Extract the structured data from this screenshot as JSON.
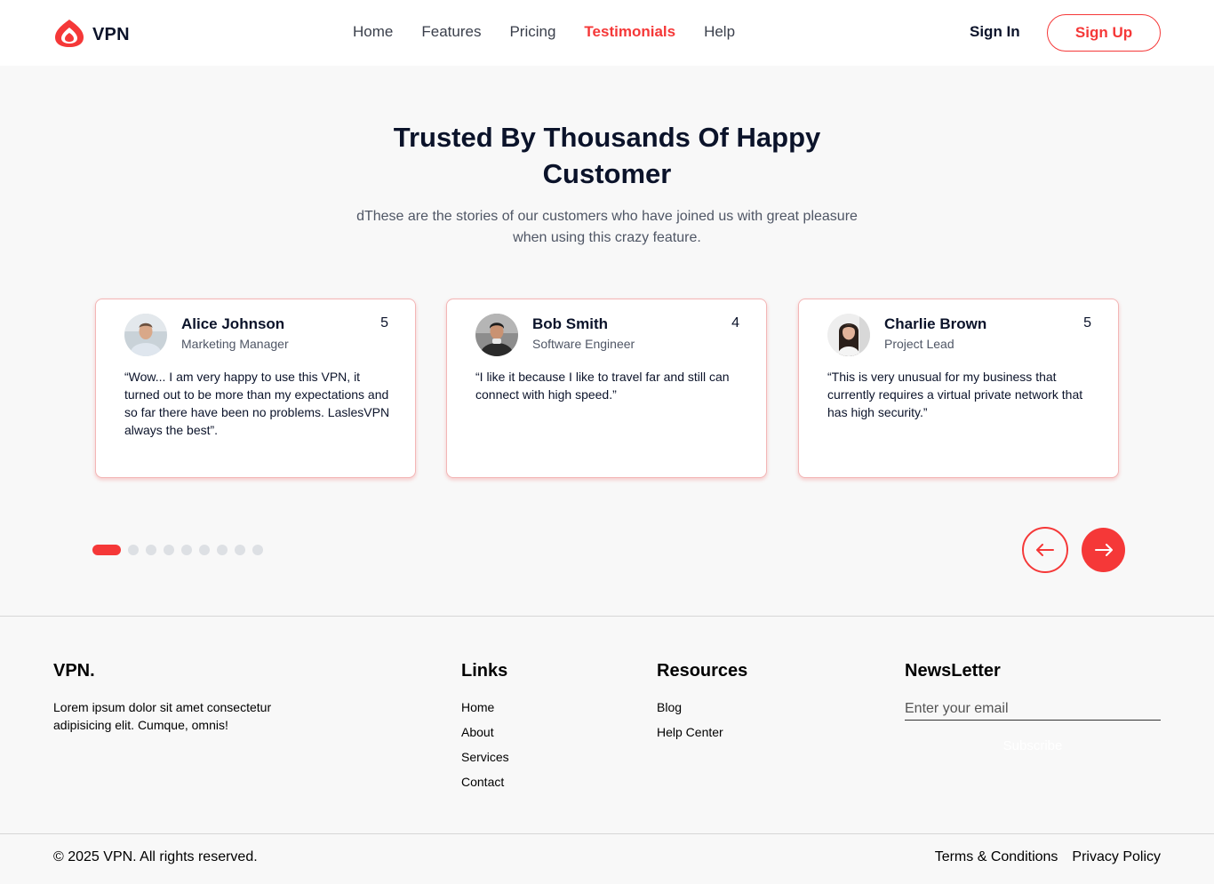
{
  "header": {
    "brand": "VPN",
    "nav": [
      {
        "label": "Home",
        "active": false
      },
      {
        "label": "Features",
        "active": false
      },
      {
        "label": "Pricing",
        "active": false
      },
      {
        "label": "Testimonials",
        "active": true
      },
      {
        "label": "Help",
        "active": false
      }
    ],
    "sign_in": "Sign In",
    "sign_up": "Sign Up"
  },
  "hero": {
    "title": "Trusted By Thousands Of Happy Customer",
    "subtitle": "dThese are the stories of our customers who have joined us with great pleasure when using this crazy feature."
  },
  "testimonials": [
    {
      "name": "Alice Johnson",
      "role": "Marketing Manager",
      "rating": "5",
      "quote": "“Wow... I am very happy to use this VPN, it turned out to be more than my expectations and so far there have been no problems. LaslesVPN always the best”.",
      "avatar": "avatar-man-light-shirt"
    },
    {
      "name": "Bob Smith",
      "role": "Software Engineer",
      "rating": "4",
      "quote": "“I like it because I like to travel far and still can connect with high speed.”",
      "avatar": "avatar-man-dark-jacket"
    },
    {
      "name": "Charlie Brown",
      "role": "Project Lead",
      "rating": "5",
      "quote": "“This is very unusual for my business that currently requires a virtual private network that has high security.”",
      "avatar": "avatar-woman-dark-hair"
    }
  ],
  "slider": {
    "total_slides": 9,
    "active_slide": 1,
    "prev_icon": "arrow-left-icon",
    "next_icon": "arrow-right-icon"
  },
  "footer": {
    "brand": "VPN.",
    "description": "Lorem ipsum dolor sit amet consectetur adipisicing elit. Cumque, omnis!",
    "links_title": "Links",
    "links": [
      "Home",
      "About",
      "Services",
      "Contact"
    ],
    "resources_title": "Resources",
    "resources": [
      "Blog",
      "Help Center"
    ],
    "newsletter_title": "NewsLetter",
    "email_placeholder": "Enter your email",
    "subscribe_label": "Subscribe",
    "copyright": "© 2025 VPN. All rights reserved.",
    "legal": [
      "Terms & Conditions",
      "Privacy Policy"
    ]
  },
  "colors": {
    "accent": "#f53838",
    "heading": "#0b132a",
    "body_text": "#4f5665",
    "background": "#f8f8f8",
    "dot_inactive": "#dde0e4"
  }
}
